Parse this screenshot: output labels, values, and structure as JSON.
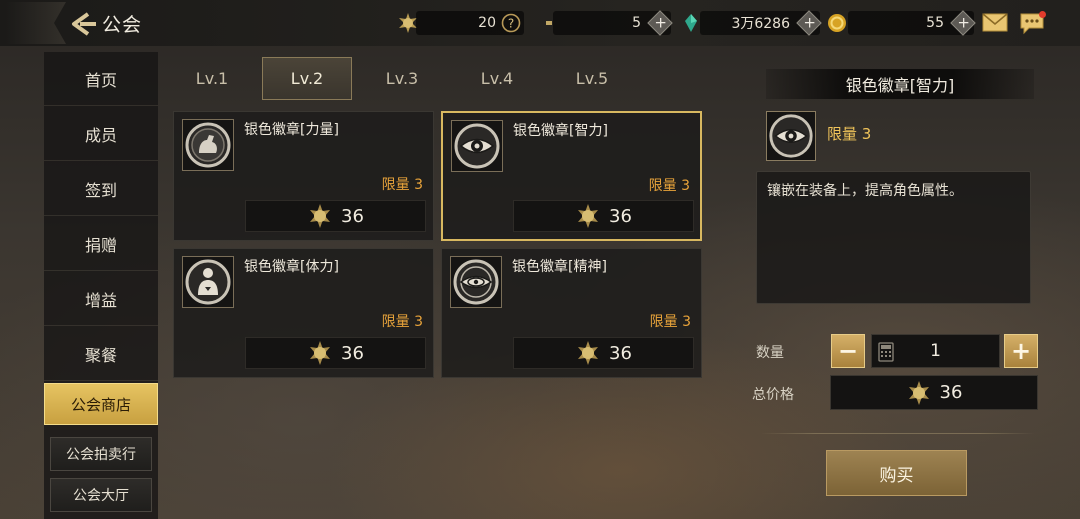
{
  "header": {
    "title": "公会",
    "resources": [
      {
        "icon": "gold-medal-icon",
        "value": "20",
        "action": "help"
      },
      {
        "icon": "moon-crescent-icon",
        "value": "5",
        "action": "plus"
      },
      {
        "icon": "green-crystal-icon",
        "value": "3万6286",
        "action": "plus"
      },
      {
        "icon": "gold-coin-icon",
        "value": "55",
        "action": "plus"
      }
    ]
  },
  "sidebar": {
    "items": [
      {
        "label": "首页"
      },
      {
        "label": "成员"
      },
      {
        "label": "签到"
      },
      {
        "label": "捐赠"
      },
      {
        "label": "增益"
      },
      {
        "label": "聚餐"
      },
      {
        "label": "公会商店",
        "active": true
      }
    ],
    "sub_items": [
      {
        "label": "公会拍卖行"
      },
      {
        "label": "公会大厅"
      }
    ]
  },
  "tabs": [
    {
      "label": "Lv.1"
    },
    {
      "label": "Lv.2",
      "active": true
    },
    {
      "label": "Lv.3"
    },
    {
      "label": "Lv.4"
    },
    {
      "label": "Lv.5"
    }
  ],
  "items": [
    {
      "name": "银色徽章[力量]",
      "icon": "strength-arm-icon",
      "limit": "限量 3",
      "price": "36"
    },
    {
      "name": "银色徽章[智力]",
      "icon": "intelligence-eye-icon",
      "limit": "限量 3",
      "price": "36",
      "selected": true
    },
    {
      "name": "银色徽章[体力]",
      "icon": "stamina-body-icon",
      "limit": "限量 3",
      "price": "36"
    },
    {
      "name": "银色徽章[精神]",
      "icon": "spirit-eye-icon",
      "limit": "限量 3",
      "price": "36"
    }
  ],
  "detail": {
    "title": "银色徽章[智力]",
    "limit": "限量 3",
    "description": "镶嵌在装备上，提高角色属性。",
    "quantity_label": "数量",
    "quantity": "1",
    "total_label": "总价格",
    "total": "36",
    "buy_label": "购买"
  },
  "colors": {
    "accent_gold": "#d8b860",
    "limit_orange": "#e8a33a",
    "active_tab_gold": "#e6c462"
  }
}
